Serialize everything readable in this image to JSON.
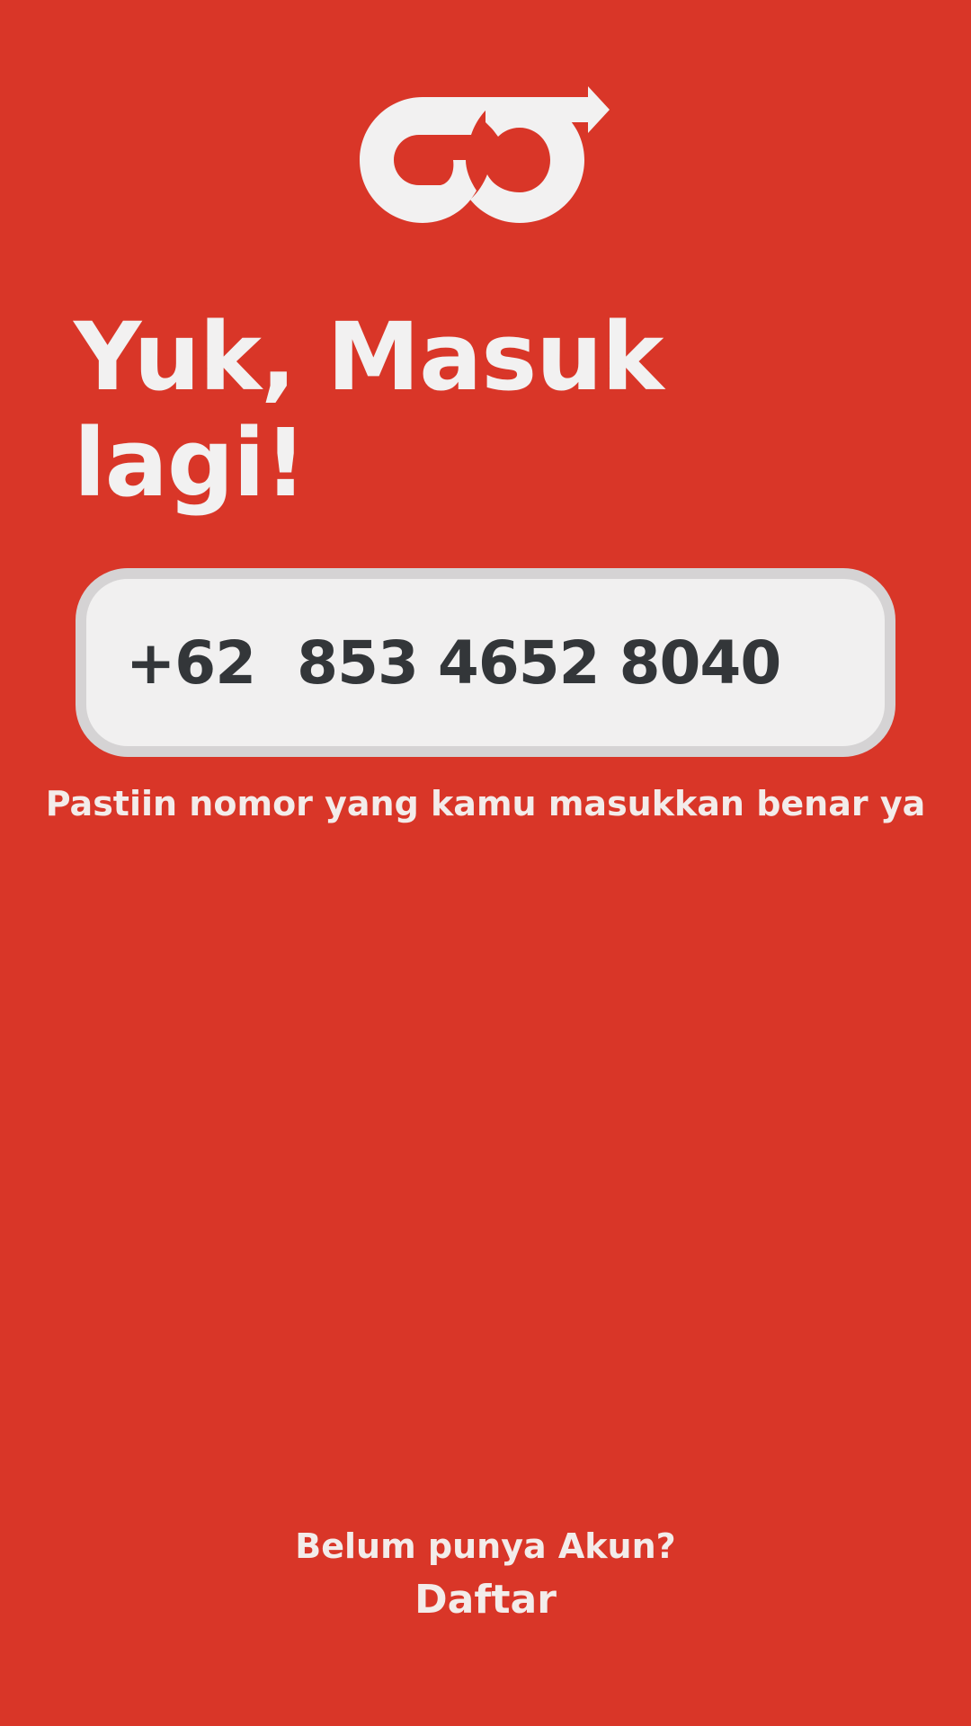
{
  "colors": {
    "background": "#D93628",
    "text_light": "#F2F1F1",
    "field_background": "#F1F0F0",
    "field_border": "#D5D3D4",
    "field_text": "#333639"
  },
  "logo": {
    "icon": "go-logo-icon"
  },
  "heading": {
    "line1": "Yuk, Masuk",
    "line2": "lagi!"
  },
  "phone": {
    "country_code": "+62",
    "number": "853 4652 8040"
  },
  "hint": "Pastiin nomor yang kamu masukkan benar ya",
  "footer": {
    "question": "Belum punya Akun?",
    "register_label": "Daftar"
  }
}
